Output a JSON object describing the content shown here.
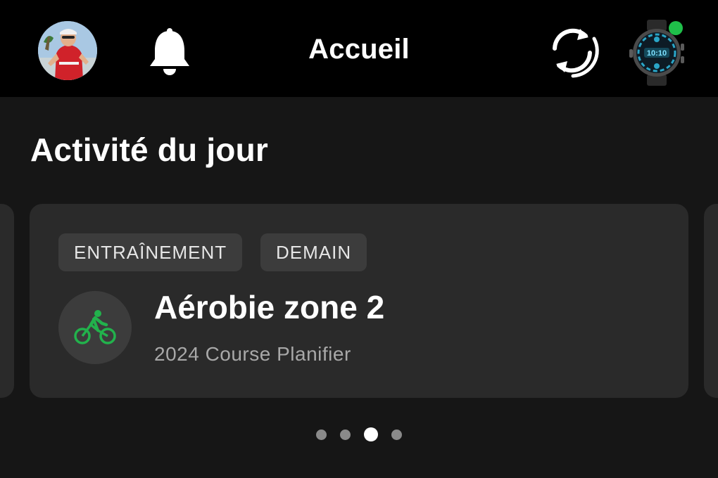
{
  "header": {
    "title": "Accueil",
    "icons": [
      "profile-avatar",
      "bell-icon",
      "sync-icon",
      "watch-icon"
    ],
    "device_connected": true,
    "status_color": "#1fbf4a"
  },
  "today": {
    "section_title": "Activité du jour",
    "card": {
      "tags": [
        "ENTRAÎNEMENT",
        "DEMAIN"
      ],
      "sport_icon": "cycling-icon",
      "sport_color": "#22b24c",
      "title": "Aérobie zone 2",
      "subtitle": "2024 Course Planifier"
    }
  },
  "pager": {
    "count": 4,
    "active_index": 2
  }
}
